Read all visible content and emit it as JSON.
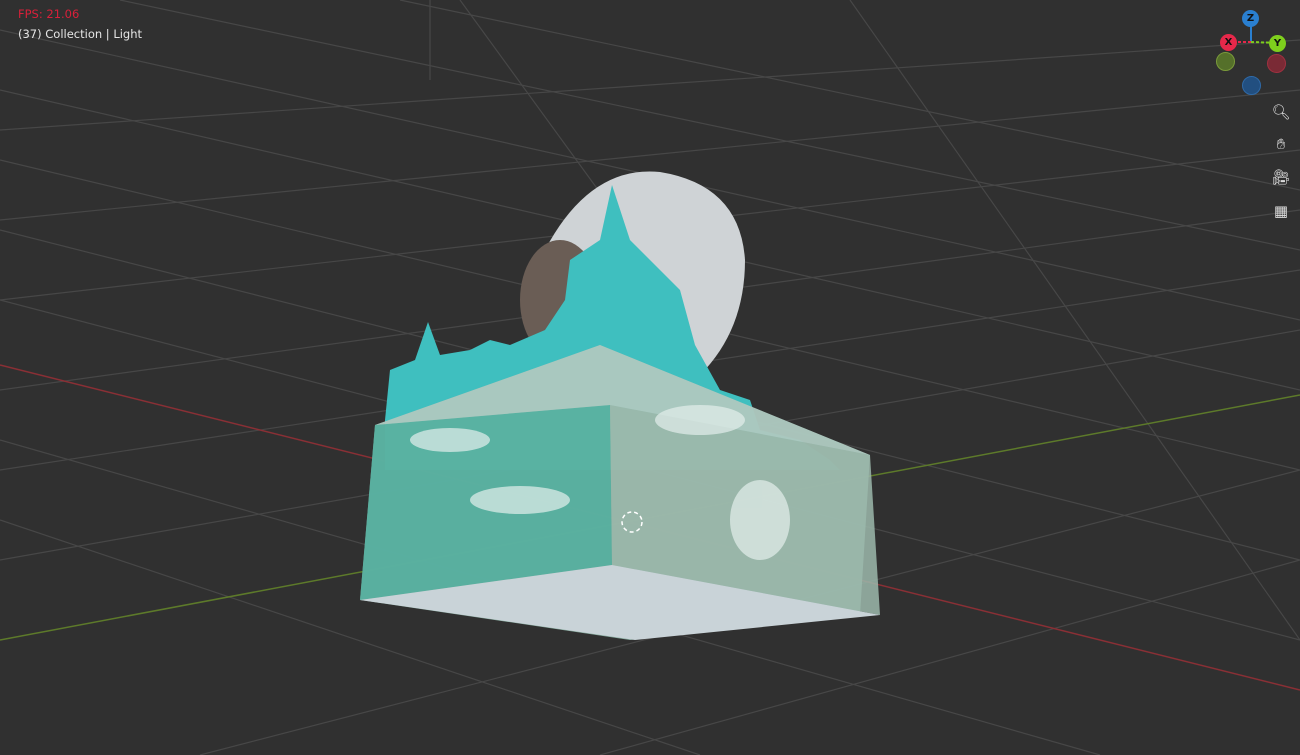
{
  "overlay": {
    "fps": "FPS: 21.06",
    "collection": "(37) Collection | Light"
  },
  "gizmo": {
    "x": "X",
    "y": "Y",
    "z": "Z"
  },
  "colors": {
    "x_axis": "#e6284a",
    "y_axis": "#7ecf1d",
    "z_axis": "#2a7fd0",
    "background": "#303030",
    "fluid": "#3fbfbf"
  },
  "nav_tools": [
    {
      "icon": "zoom-icon"
    },
    {
      "icon": "hand-pan-icon"
    },
    {
      "icon": "camera-icon"
    },
    {
      "icon": "grid-perspective-icon"
    }
  ]
}
